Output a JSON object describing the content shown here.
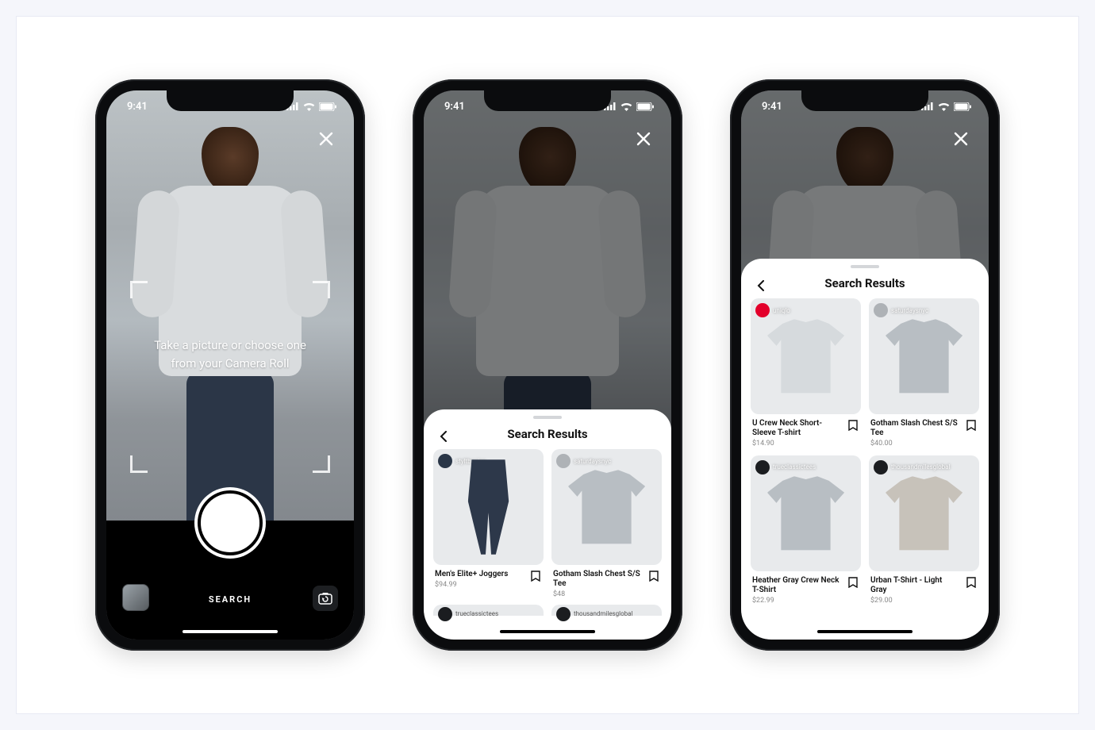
{
  "status": {
    "time": "9:41"
  },
  "camera": {
    "hint": "Take a picture or choose one from your Camera Roll",
    "search_label": "SEARCH"
  },
  "sheet": {
    "title": "Search Results"
  },
  "phone2_products": [
    {
      "brand": "styltbasics",
      "title": "Men's Elite+ Joggers",
      "price": "$94.99"
    },
    {
      "brand": "saturdaysnyc",
      "title": "Gotham Slash Chest S/S Tee",
      "price": "$48"
    }
  ],
  "phone2_peek": [
    {
      "brand": "trueclassictees"
    },
    {
      "brand": "thousandmilesglobal"
    }
  ],
  "phone3_products": [
    {
      "brand": "uniqlo",
      "title": "U Crew Neck Short-Sleeve T-shirt",
      "price": "$14.90"
    },
    {
      "brand": "saturdaysnyc",
      "title": "Gotham Slash Chest S/S Tee",
      "price": "$40.00"
    },
    {
      "brand": "trueclassictees",
      "title": "Heather Gray Crew Neck T-Shirt",
      "price": "$22.99"
    },
    {
      "brand": "thousandmilesglobal",
      "title": "Urban T-Shirt - Light Gray",
      "price": "$29.00"
    }
  ]
}
